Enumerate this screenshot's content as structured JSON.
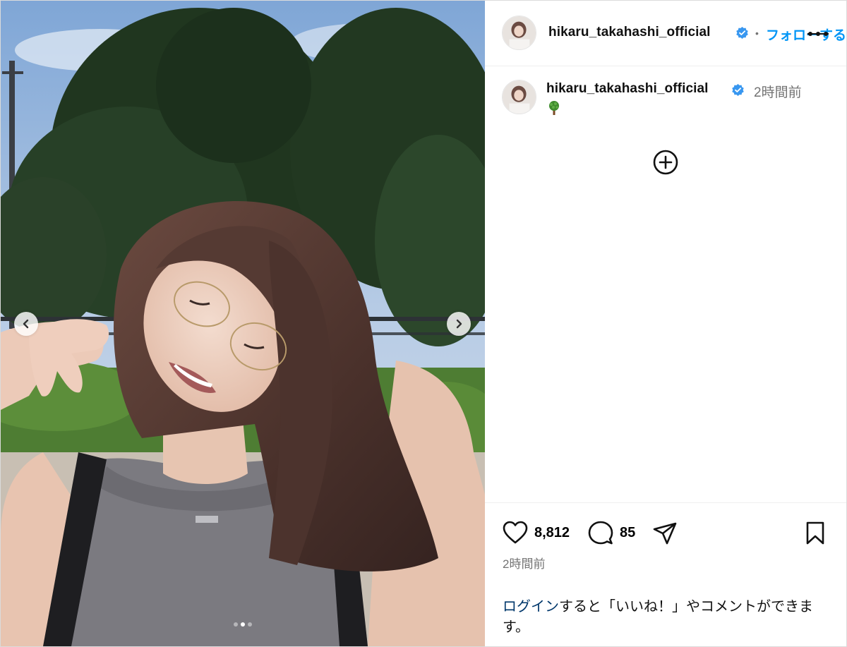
{
  "post": {
    "username": "hikaru_takahashi_official",
    "follow_label": "フォローする",
    "separator": "•",
    "time_ago": "2時間前",
    "caption_emoji_name": "tree-emoji",
    "likes": "8,812",
    "comments": "85",
    "footer_time": "2時間前",
    "login_link": "ログイン",
    "login_rest": "すると「いいね！」やコメントができます。"
  },
  "carousel": {
    "slide_count": 3,
    "active_slide": 2
  },
  "colors": {
    "accent": "#0095f6",
    "verified": "#3897f0",
    "muted": "#737373",
    "link_dark": "#00376b"
  },
  "icons": [
    "verified-badge-icon",
    "more-options-icon",
    "add-comment-icon",
    "heart-icon",
    "comment-icon",
    "share-icon",
    "bookmark-icon",
    "chevron-left-icon",
    "chevron-right-icon"
  ]
}
